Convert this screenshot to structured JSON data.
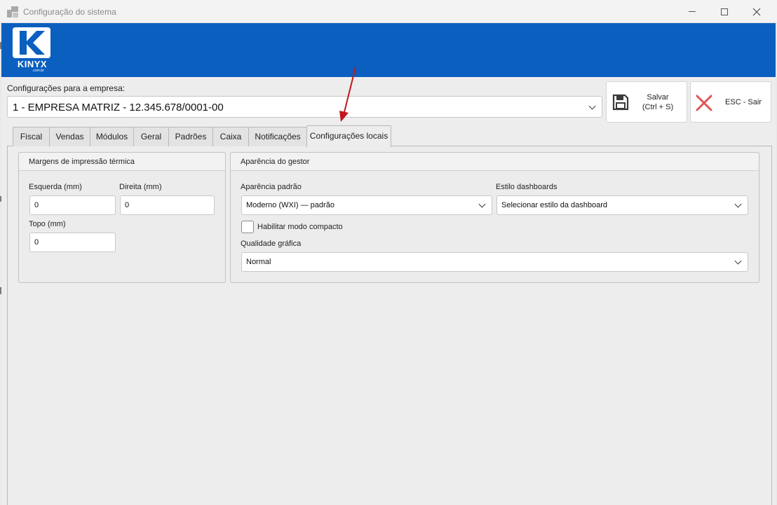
{
  "window": {
    "title": "Configuração do sistema",
    "icon": "app-grid-icon"
  },
  "brand": {
    "name": "KINYX",
    "subtitle": ".com.br",
    "color": "#0a5fbf"
  },
  "company": {
    "label": "Configurações para a empresa:",
    "value": "1 - EMPRESA MATRIZ - 12.345.678/0001-00"
  },
  "actions": {
    "save_label": "Salvar\n(Ctrl + S)",
    "save_icon": "floppy-disk-icon",
    "exit_label": "ESC - Sair",
    "exit_icon": "close-x-icon",
    "exit_color": "#e05555"
  },
  "tabs": [
    {
      "label": "Fiscal"
    },
    {
      "label": "Vendas"
    },
    {
      "label": "Módulos"
    },
    {
      "label": "Geral"
    },
    {
      "label": "Padrões"
    },
    {
      "label": "Caixa"
    },
    {
      "label": "Notificações"
    },
    {
      "label": "Configurações locais"
    }
  ],
  "active_tab": "Configurações locais",
  "margins": {
    "title": "Margens de impressão térmica",
    "left_label": "Esquerda (mm)",
    "left_value": "0",
    "right_label": "Direita (mm)",
    "right_value": "0",
    "top_label": "Topo (mm)",
    "top_value": "0"
  },
  "appearance": {
    "title": "Aparência do gestor",
    "default_label": "Aparência padrão",
    "default_value": "Moderno (WXI) — padrão",
    "dashboard_label": "Estilo dashboards",
    "dashboard_value": "Selecionar estilo da dashboard",
    "compact_label": "Habilitar modo compacto",
    "compact_checked": false,
    "quality_label": "Qualidade gráfica",
    "quality_value": "Normal"
  },
  "annotation": {
    "type": "arrow",
    "color": "#c0181d"
  }
}
